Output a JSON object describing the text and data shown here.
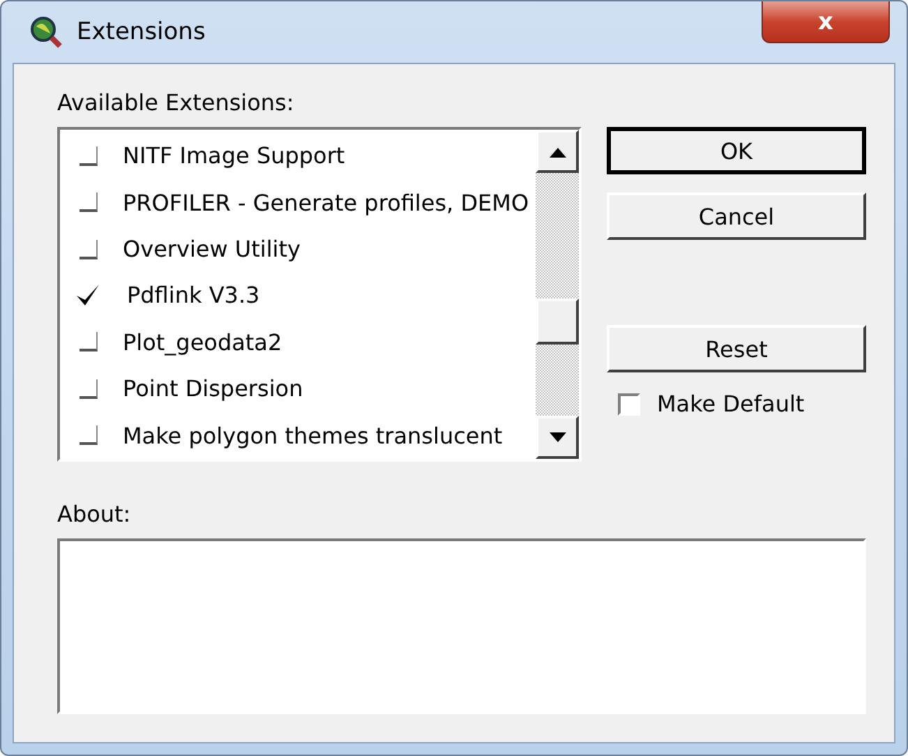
{
  "window": {
    "title": "Extensions",
    "close": "x"
  },
  "list": {
    "label": "Available Extensions:",
    "items": [
      {
        "label": "NITF Image Support",
        "checked": false
      },
      {
        "label": "PROFILER - Generate profiles, DEMO",
        "checked": false
      },
      {
        "label": "Overview Utility",
        "checked": false
      },
      {
        "label": "Pdflink V3.3",
        "checked": true
      },
      {
        "label": "Plot_geodata2",
        "checked": false
      },
      {
        "label": "Point Dispersion",
        "checked": false
      },
      {
        "label": "Make polygon themes translucent",
        "checked": false
      }
    ]
  },
  "buttons": [
    {
      "label": "OK",
      "default": true
    },
    {
      "label": "Cancel",
      "default": false
    },
    {
      "label": "Reset",
      "default": false
    }
  ],
  "make_default": {
    "label": "Make Default",
    "checked": false
  },
  "about": {
    "label": "About:"
  }
}
